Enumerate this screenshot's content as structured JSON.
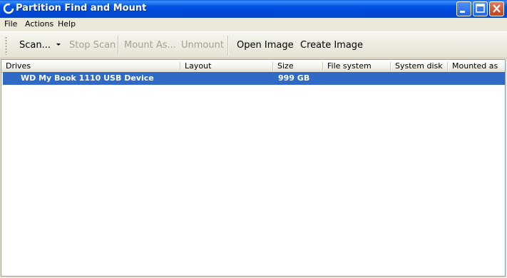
{
  "window": {
    "title": "Partition Find and Mount"
  },
  "title_buttons": {
    "minimize_icon": "minimize-icon",
    "maximize_icon": "maximize-icon",
    "close_icon": "close-icon"
  },
  "menu": {
    "items": [
      "File",
      "Actions",
      "Help"
    ]
  },
  "toolbar": {
    "scan": "Scan...",
    "stop_scan": "Stop Scan",
    "mount_as": "Mount As...",
    "unmount": "Unmount",
    "open_image": "Open Image",
    "create_image": "Create Image"
  },
  "table": {
    "columns": [
      "Drives",
      "Layout",
      "Size",
      "File system",
      "System disk",
      "Mounted as"
    ],
    "rows": [
      {
        "drive": "WD My Book 1110 USB Device",
        "layout": "",
        "size": "999 GB",
        "file_system": "",
        "system_disk": "",
        "mounted_as": "",
        "selected": true
      }
    ]
  },
  "colors": {
    "title_bar": "#0055e5",
    "selection": "#316ac5",
    "disabled_text": "#a4a196"
  }
}
